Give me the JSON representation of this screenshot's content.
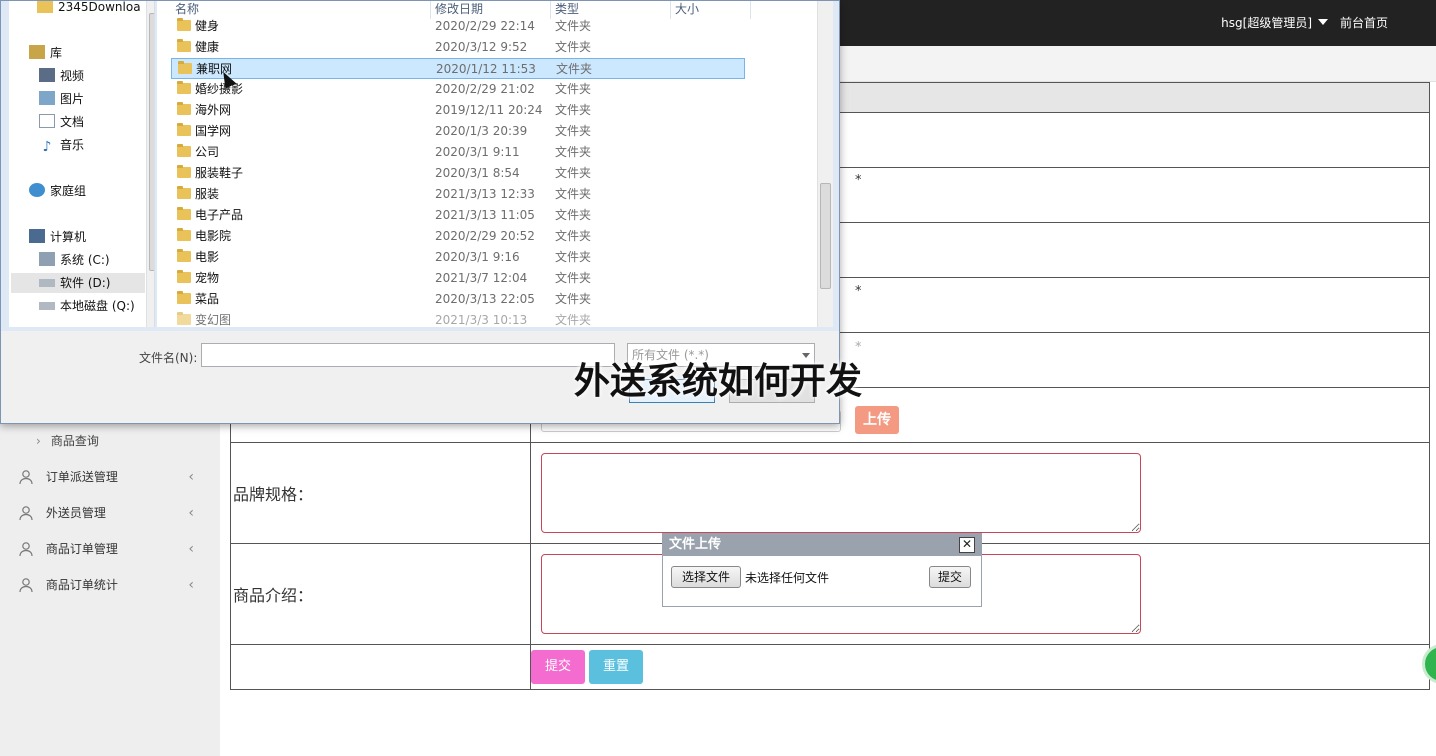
{
  "topbar": {
    "user_label": "hsg[超级管理员]",
    "home_label": "前台首页",
    "bg_color": "#222222"
  },
  "sidebar": {
    "subitem": "商品查询",
    "items": [
      {
        "label": "订单派送管理",
        "icon": "user-icon"
      },
      {
        "label": "外送员管理",
        "icon": "user-icon"
      },
      {
        "label": "商品订单管理",
        "icon": "user-icon"
      },
      {
        "label": "商品订单统计",
        "icon": "user-icon"
      }
    ]
  },
  "form": {
    "required_mark": "*",
    "spec_label": "品牌规格：",
    "intro_label": "商品介绍：",
    "upload_button": "上传",
    "submit_button": "提交",
    "reset_button": "重置",
    "colors": {
      "submit": "#f46ccf",
      "reset": "#5bc0de",
      "textarea_border": "#c9455a"
    }
  },
  "upload_popup": {
    "title": "文件上传",
    "close_icon": "close-icon",
    "choose_button": "选择文件",
    "no_file_text": "未选择任何文件",
    "submit_button": "提交"
  },
  "file_dialog": {
    "nav": {
      "top_folder": "2345Downloa",
      "library": "库",
      "library_items": [
        "视频",
        "图片",
        "文档",
        "音乐"
      ],
      "homegroup": "家庭组",
      "computer": "计算机",
      "drives": [
        "系统 (C:)",
        "软件 (D:)",
        "本地磁盘 (Q:)"
      ],
      "selected_drive": "软件 (D:)"
    },
    "columns": [
      "名称",
      "修改日期",
      "类型",
      "大小"
    ],
    "files": [
      {
        "name": "健身",
        "date": "2020/2/29 22:14",
        "type": "文件夹"
      },
      {
        "name": "健康",
        "date": "2020/3/12 9:52",
        "type": "文件夹"
      },
      {
        "name": "兼职网",
        "date": "2020/1/12 11:53",
        "type": "文件夹",
        "selected": true
      },
      {
        "name": "婚纱摄影",
        "date": "2020/2/29 21:02",
        "type": "文件夹"
      },
      {
        "name": "海外网",
        "date": "2019/12/11 20:24",
        "type": "文件夹"
      },
      {
        "name": "国学网",
        "date": "2020/1/3 20:39",
        "type": "文件夹"
      },
      {
        "name": "公司",
        "date": "2020/3/1 9:11",
        "type": "文件夹"
      },
      {
        "name": "服装鞋子",
        "date": "2020/3/1 8:54",
        "type": "文件夹"
      },
      {
        "name": "服装",
        "date": "2021/3/13 12:33",
        "type": "文件夹"
      },
      {
        "name": "电子产品",
        "date": "2021/3/13 11:05",
        "type": "文件夹"
      },
      {
        "name": "电影院",
        "date": "2020/2/29 20:52",
        "type": "文件夹"
      },
      {
        "name": "电影",
        "date": "2020/3/1 9:16",
        "type": "文件夹"
      },
      {
        "name": "宠物",
        "date": "2021/3/7 12:04",
        "type": "文件夹"
      },
      {
        "name": "菜品",
        "date": "2020/3/13 22:05",
        "type": "文件夹"
      },
      {
        "name": "变幻图",
        "date": "2021/3/3 10:13",
        "type": "文件夹"
      }
    ],
    "filename_label": "文件名(N):",
    "filename_value": "",
    "filetype_value": "所有文件 (*.*)"
  },
  "overlay_title": "外送系统如何开发"
}
